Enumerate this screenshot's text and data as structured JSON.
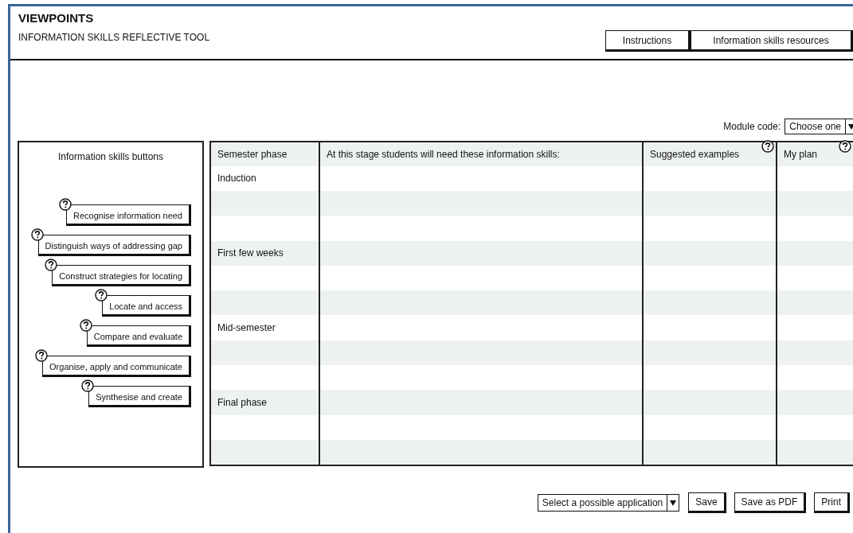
{
  "app": {
    "title": "VIEWPOINTS",
    "subtitle": "INFORMATION SKILLS REFLECTIVE TOOL"
  },
  "header_buttons": [
    "Instructions",
    "Information skills resources"
  ],
  "module_code": {
    "label": "Module code:",
    "value": "Choose one"
  },
  "skills_panel": {
    "title": "Information skills buttons",
    "buttons": [
      {
        "label": "Recognise information need"
      },
      {
        "label": "Distinguish ways of addressing gap"
      },
      {
        "label": "Construct strategies for locating"
      },
      {
        "label": "Locate and access"
      },
      {
        "label": "Compare and evaluate"
      },
      {
        "label": "Organise, apply and communicate"
      },
      {
        "label": "Synthesise and create"
      }
    ]
  },
  "table": {
    "columns": [
      {
        "label": "Semester phase",
        "help": false
      },
      {
        "label": "At this stage students will need these information skills:",
        "help": false
      },
      {
        "label": "Suggested examples",
        "help": true
      },
      {
        "label": "My plan",
        "help": true
      }
    ],
    "phases": [
      {
        "label": "Induction"
      },
      {
        "label": "First few weeks"
      },
      {
        "label": "Mid-semester"
      },
      {
        "label": "Final phase"
      }
    ]
  },
  "footer": {
    "application_select": "Select a possible application",
    "buttons": [
      "Save",
      "Save as PDF",
      "Print"
    ]
  }
}
